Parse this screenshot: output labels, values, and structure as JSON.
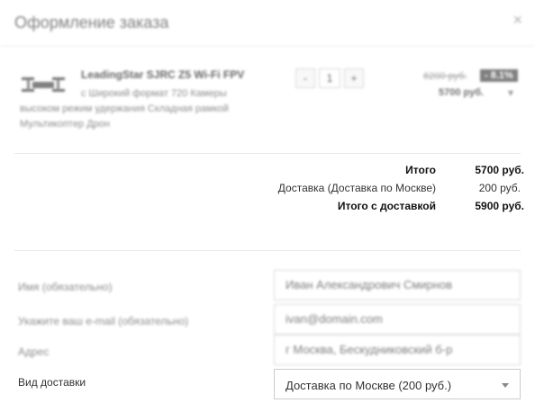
{
  "modal": {
    "title": "Оформление заказа",
    "close_symbol": "×"
  },
  "cart_item": {
    "name": "LeadingStar SJRC Z5 Wi-Fi FPV",
    "description": "с Широкий формат 720 Камеры высоком режим удержания Складная рамкой Мультикоптер Дрон",
    "quantity_minus": "-",
    "quantity": "1",
    "quantity_plus": "+",
    "old_price": "6200 руб.",
    "discount": "- 8.1%",
    "price": "5700 руб.",
    "remove_icon": "chevron-down-icon"
  },
  "totals": {
    "subtotal_label": "Итого",
    "subtotal_value": "5700 руб.",
    "shipping_label": "Доставка (Доставка по Москве)",
    "shipping_value": "200 руб.",
    "grand_total_label": "Итого с доставкой",
    "grand_total_value": "5900 руб."
  },
  "form": {
    "name_label": "Имя (обязательно)",
    "name_value": "Иван Александрович Смирнов",
    "email_label": "Укажите ваш e-mail (обязательно)",
    "email_value": "ivan@domain.com",
    "address_label": "Адрес",
    "address_value": "г Москва, Бескудниковский б-р",
    "delivery_label": "Вид доставки",
    "delivery_value": "Доставка по Москве (200 руб.)"
  }
}
